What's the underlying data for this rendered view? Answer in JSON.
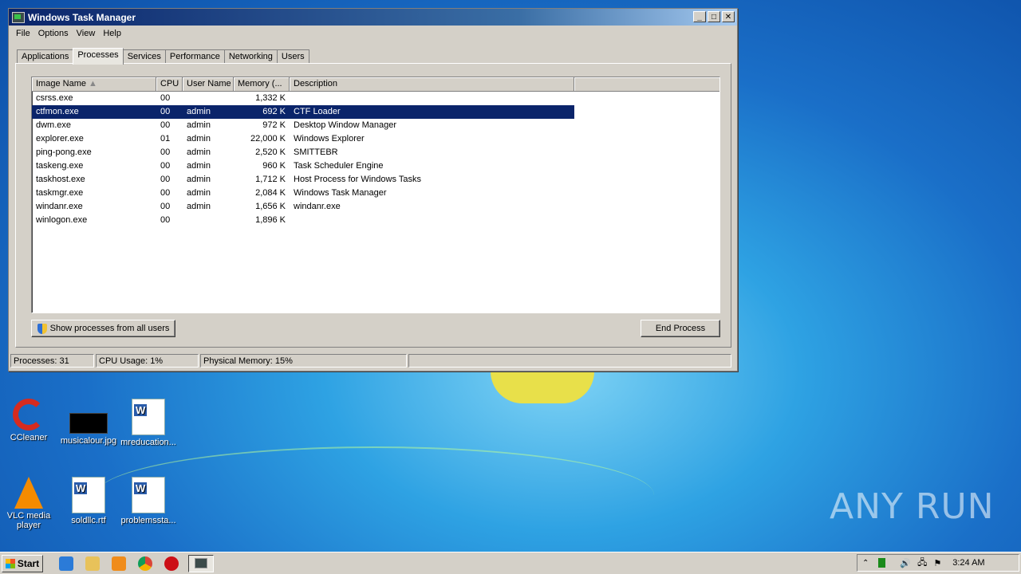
{
  "window": {
    "title": "Windows Task Manager"
  },
  "menu": [
    "File",
    "Options",
    "View",
    "Help"
  ],
  "tabs": [
    "Applications",
    "Processes",
    "Services",
    "Performance",
    "Networking",
    "Users"
  ],
  "active_tab": "Processes",
  "columns": [
    "Image Name",
    "CPU",
    "User Name",
    "Memory (...",
    "Description"
  ],
  "processes": [
    {
      "name": "csrss.exe",
      "cpu": "00",
      "user": "",
      "memory": "1,332 K",
      "desc": ""
    },
    {
      "name": "ctfmon.exe",
      "cpu": "00",
      "user": "admin",
      "memory": "692 K",
      "desc": "CTF Loader"
    },
    {
      "name": "dwm.exe",
      "cpu": "00",
      "user": "admin",
      "memory": "972 K",
      "desc": "Desktop Window Manager"
    },
    {
      "name": "explorer.exe",
      "cpu": "01",
      "user": "admin",
      "memory": "22,000 K",
      "desc": "Windows Explorer"
    },
    {
      "name": "ping-pong.exe",
      "cpu": "00",
      "user": "admin",
      "memory": "2,520 K",
      "desc": "SMITTEBR"
    },
    {
      "name": "taskeng.exe",
      "cpu": "00",
      "user": "admin",
      "memory": "960 K",
      "desc": "Task Scheduler Engine"
    },
    {
      "name": "taskhost.exe",
      "cpu": "00",
      "user": "admin",
      "memory": "1,712 K",
      "desc": "Host Process for Windows Tasks"
    },
    {
      "name": "taskmgr.exe",
      "cpu": "00",
      "user": "admin",
      "memory": "2,084 K",
      "desc": "Windows Task Manager"
    },
    {
      "name": "windanr.exe",
      "cpu": "00",
      "user": "admin",
      "memory": "1,656 K",
      "desc": "windanr.exe"
    },
    {
      "name": "winlogon.exe",
      "cpu": "00",
      "user": "",
      "memory": "1,896 K",
      "desc": ""
    }
  ],
  "selected_process": "ctfmon.exe",
  "buttons": {
    "show_all": "Show processes from all users",
    "end_process": "End Process"
  },
  "status": {
    "processes": "Processes: 31",
    "cpu": "CPU Usage: 1%",
    "memory": "Physical Memory: 15%"
  },
  "desktop_icons": [
    {
      "label": "CCleaner",
      "icon": "ccleaner-icon"
    },
    {
      "label": "musicalour.jpg",
      "icon": "image-file-icon"
    },
    {
      "label": "mreducation...",
      "icon": "word-doc-icon"
    },
    {
      "label": "VLC media player",
      "icon": "vlc-icon"
    },
    {
      "label": "soldllc.rtf",
      "icon": "word-doc-icon"
    },
    {
      "label": "problemssta...",
      "icon": "word-doc-icon"
    }
  ],
  "taskbar": {
    "start_label": "Start",
    "clock": "3:24 AM"
  },
  "watermark": "ANY RUN"
}
